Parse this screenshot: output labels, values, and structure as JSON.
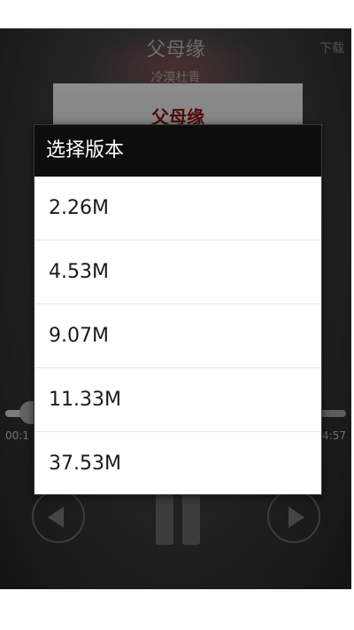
{
  "player": {
    "song_title": "父母缘",
    "artist": "冷漠杜青",
    "download_label": "下载",
    "cover_title": "父母缘",
    "time_current": "00:1",
    "time_total": "4:57",
    "progress_fraction": 0.07
  },
  "dialog": {
    "title": "选择版本",
    "options": [
      {
        "label": "2.26M"
      },
      {
        "label": "4.53M"
      },
      {
        "label": "9.07M"
      },
      {
        "label": "11.33M"
      },
      {
        "label": "37.53M"
      }
    ]
  },
  "colors": {
    "dialog_header_bg": "#0d0d0d",
    "dialog_bg": "#ffffff"
  },
  "icons": [
    "previous-icon",
    "pause-icon",
    "next-icon"
  ]
}
